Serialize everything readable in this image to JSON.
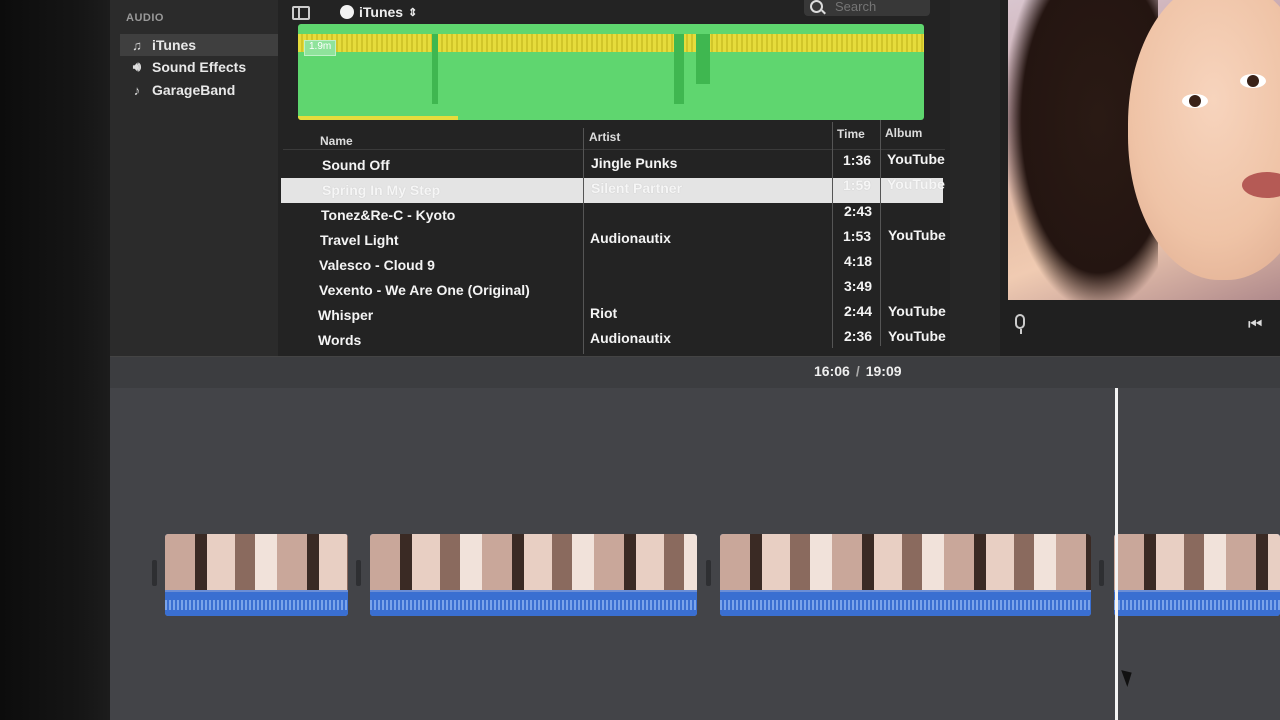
{
  "sidebar": {
    "header": "AUDIO",
    "items": [
      {
        "label": "iTunes",
        "icon": "music-note-icon",
        "selected": true
      },
      {
        "label": "Sound Effects",
        "icon": "speaker-icon",
        "selected": false
      },
      {
        "label": "GarageBand",
        "icon": "guitar-icon",
        "selected": false
      }
    ]
  },
  "toolbar": {
    "library_label": "iTunes",
    "search_placeholder": "Search"
  },
  "waveform": {
    "length_label": "1.9m"
  },
  "table": {
    "columns": [
      "Name",
      "Artist",
      "Time",
      "Album"
    ],
    "rows": [
      {
        "name": "Sound Off",
        "artist": "Jingle Punks",
        "time": "1:36",
        "album": "YouTube"
      },
      {
        "name": "Spring In My Step",
        "artist": "Silent Partner",
        "time": "1:59",
        "album": "YouTube",
        "selected": true
      },
      {
        "name": "Tonez&Re-C - Kyoto",
        "artist": "",
        "time": "2:43",
        "album": ""
      },
      {
        "name": "Travel Light",
        "artist": "Audionautix",
        "time": "1:53",
        "album": "YouTube"
      },
      {
        "name": "Valesco - Cloud 9",
        "artist": "",
        "time": "4:18",
        "album": ""
      },
      {
        "name": "Vexento - We Are One (Original)",
        "artist": "",
        "time": "3:49",
        "album": ""
      },
      {
        "name": "Whisper",
        "artist": "Riot",
        "time": "2:44",
        "album": "YouTube"
      },
      {
        "name": "Words",
        "artist": "Audionautix",
        "time": "2:36",
        "album": "YouTube"
      }
    ]
  },
  "timeline": {
    "current_time": "16:06",
    "separator": "/",
    "total_time": "19:09"
  },
  "colors": {
    "waveform_green": "#5fd66f",
    "waveform_yellow": "#e6dc3c",
    "audio_blue": "#3a6fd1"
  }
}
